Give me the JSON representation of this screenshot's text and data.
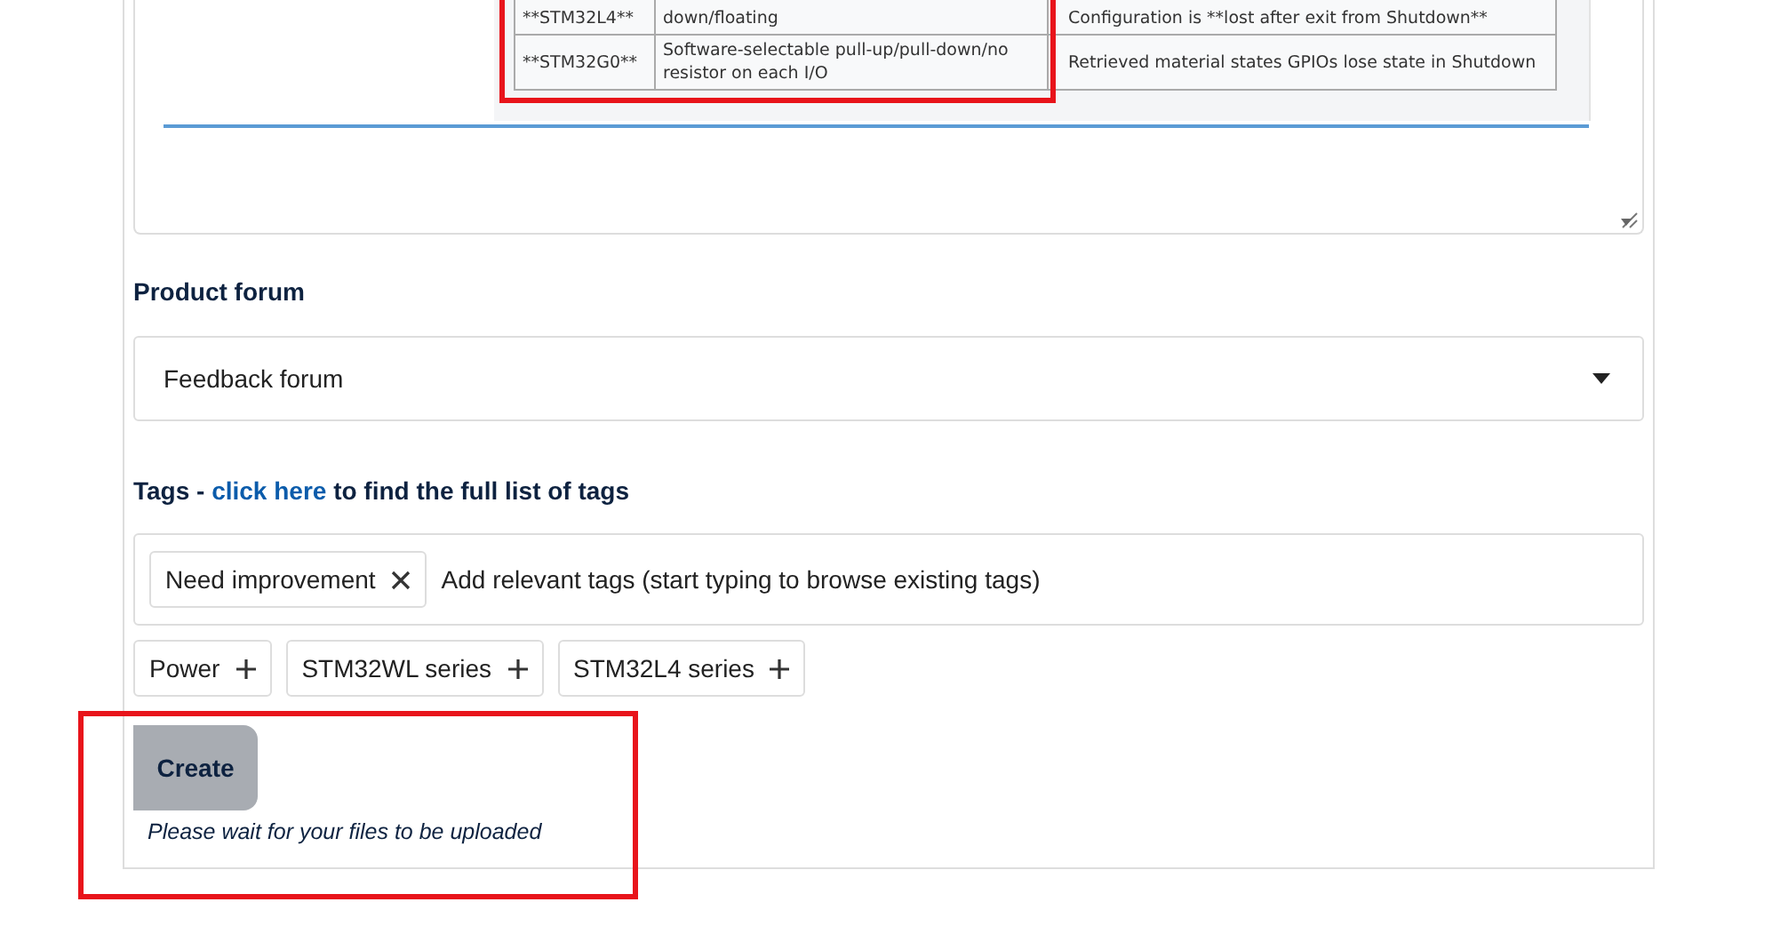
{
  "editor": {
    "embedded_table": {
      "rows": [
        [
          "**STM32L4**",
          "down/floating",
          "Configuration is **lost after exit from Shutdown**"
        ],
        [
          "**STM32G0**",
          "Software-selectable pull-up/pull-down/no resistor on each I/O",
          "Retrieved material states GPIOs lose state in Shutdown"
        ]
      ]
    }
  },
  "product_forum": {
    "label": "Product forum",
    "value": "Feedback forum"
  },
  "tags": {
    "label": "Tags - ",
    "link": "click here",
    "label_rest": " to find the full list of tags",
    "selected": [
      {
        "label": "Need improvement"
      }
    ],
    "placeholder": "Add relevant tags (start typing to browse existing tags)",
    "suggestions": [
      {
        "label": "Power"
      },
      {
        "label": "STM32WL series"
      },
      {
        "label": "STM32L4 series"
      }
    ]
  },
  "create_button": {
    "label": "Create",
    "disabled": true
  },
  "upload_note": "Please wait for your files to be uploaded"
}
